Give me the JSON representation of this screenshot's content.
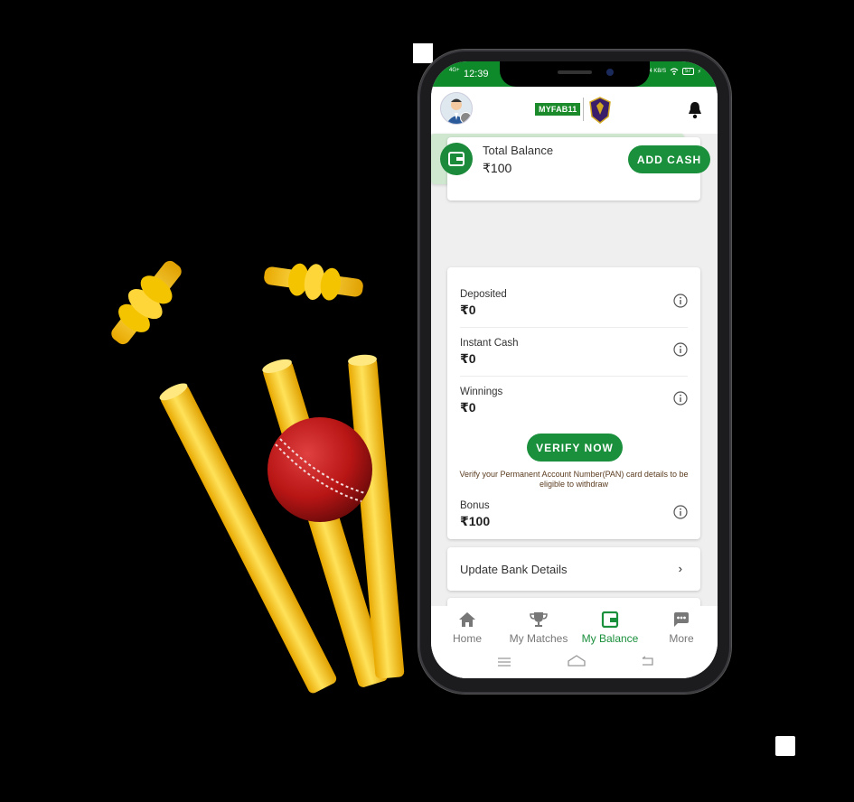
{
  "statusbar": {
    "network": "4G+",
    "time": "12:39",
    "speed": "75.4 KB/S",
    "battery": "57"
  },
  "header": {
    "logo_text": "MYFAB11",
    "avatar_icon": "user-avatar-icon",
    "team_logo_icon": "team-crest-icon",
    "bell_icon": "bell-icon"
  },
  "balance": {
    "label": "Total Balance",
    "value": "₹100",
    "add_cash_label": "ADD CASH",
    "icon": "wallet-icon"
  },
  "details": {
    "rows": [
      {
        "label": "Deposited",
        "value": "₹0"
      },
      {
        "label": "Instant Cash",
        "value": "₹0"
      },
      {
        "label": "Winnings",
        "value": "₹0"
      },
      {
        "label": "Bonus",
        "value": "₹100"
      }
    ],
    "verify_label": "VERIFY NOW",
    "verify_note": "Verify your Permanent Account Number(PAN) card details to be eligible to withdraw"
  },
  "bank": {
    "label": "Update Bank Details",
    "chevron": "›"
  },
  "nav": {
    "items": [
      {
        "label": "Home",
        "icon": "home-icon"
      },
      {
        "label": "My Matches",
        "icon": "trophy-icon"
      },
      {
        "label": "My Balance",
        "icon": "wallet-icon",
        "active": true
      },
      {
        "label": "More",
        "icon": "more-icon"
      }
    ]
  },
  "colors": {
    "brand_green": "#1a8f3c",
    "status_green": "#0e8a2a",
    "balance_bg": "#cfe6cf"
  }
}
